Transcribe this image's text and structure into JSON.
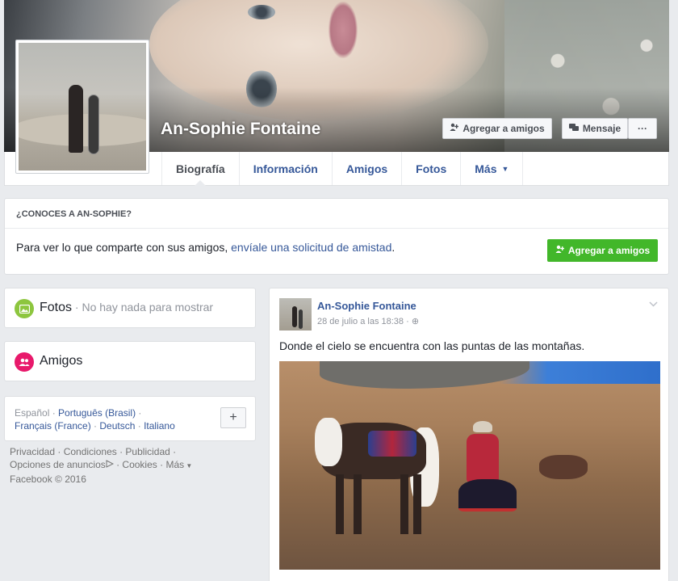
{
  "profile": {
    "name": "An-Sophie Fontaine"
  },
  "cover_actions": {
    "add_friend": "Agregar a amigos",
    "message": "Mensaje",
    "more": "···"
  },
  "nav": {
    "tabs": [
      {
        "label": "Biografía",
        "active": true
      },
      {
        "label": "Información"
      },
      {
        "label": "Amigos"
      },
      {
        "label": "Fotos"
      },
      {
        "label": "Más"
      }
    ]
  },
  "know": {
    "title": "¿CONOCES A AN-SOPHIE?",
    "text": "Para ver lo que comparte con sus amigos, ",
    "link": "envíale una solicitud de amistad",
    "link_suffix": ".",
    "button": "Agregar a amigos"
  },
  "sidebar": {
    "photos_title": "Fotos",
    "photos_sub": " · No hay nada para mostrar",
    "friends_title": "Amigos",
    "languages": {
      "current": "Español",
      "sep": " · ",
      "links": [
        "Português (Brasil)",
        "Français (France)",
        "Deutsch",
        "Italiano"
      ],
      "add": "+"
    },
    "footer": {
      "privacy": "Privacidad",
      "terms": "Condiciones",
      "advertising": "Publicidad",
      "ad_choices": "Opciones de anuncios",
      "cookies": "Cookies",
      "more": "Más",
      "copyright": "Facebook © 2016"
    }
  },
  "post": {
    "author": "An-Sophie Fontaine",
    "date": "28 de julio a las 18:38",
    "privacy_glyph": "⊕",
    "text": "Donde el cielo se encuentra con las puntas de las montañas."
  }
}
